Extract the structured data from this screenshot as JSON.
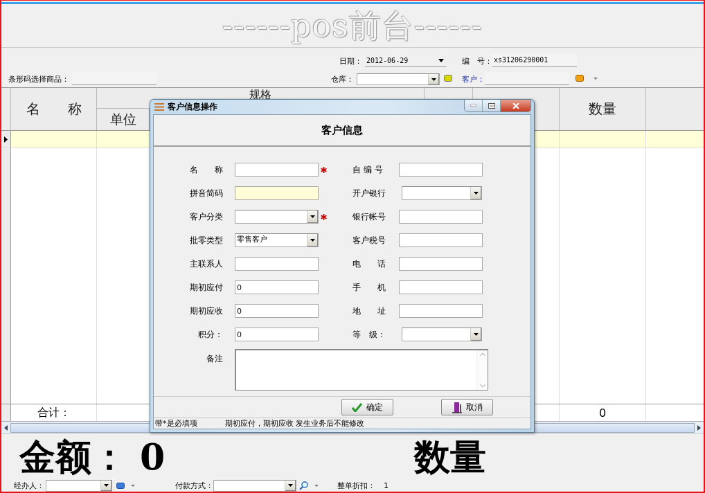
{
  "app_title": "------pos前台------",
  "header": {
    "date": {
      "label": "日期：",
      "value": "2012-06-29"
    },
    "number": {
      "label": "编　号：",
      "value": "xs31206290001"
    },
    "barcode": {
      "label": "条形码选择商品："
    },
    "warehouse": {
      "label": "仓库："
    },
    "customer": {
      "label": "客户："
    }
  },
  "table": {
    "columns": [
      {
        "label": "名　　称"
      },
      {
        "label": "规格",
        "sub": [
          {
            "label": "单位"
          }
        ]
      },
      {},
      {},
      {
        "label": "数量"
      },
      {}
    ],
    "rows": [
      {
        "selected": true
      }
    ],
    "totals": {
      "label": "合计：",
      "quantity": "0"
    }
  },
  "summary": {
    "amount_label": "金额：",
    "amount": "0",
    "quantity_label": "数量"
  },
  "footer": {
    "handler": {
      "label": "经办人："
    },
    "payment": {
      "label": "付款方式："
    },
    "discount": {
      "label": "整单折扣：",
      "value": "1"
    }
  },
  "dialog": {
    "title": "客户信息操作",
    "heading": "客户信息",
    "fields": [
      {
        "label": "名　　称",
        "kind": "text",
        "required": true
      },
      {
        "label": "自 编 号",
        "kind": "text",
        "required": false
      },
      {
        "label": "拼音简码",
        "kind": "text",
        "required": false,
        "highlighted": true
      },
      {
        "label": "开户银行",
        "kind": "combo",
        "required": false
      },
      {
        "label": "客户分类",
        "kind": "combo",
        "required": true
      },
      {
        "label": "银行帐号",
        "kind": "text",
        "required": false
      },
      {
        "label": "批零类型",
        "kind": "combo",
        "required": false,
        "value": "零售客户"
      },
      {
        "label": "客户税号",
        "kind": "text",
        "required": false
      },
      {
        "label": "主联系人",
        "kind": "text",
        "required": false
      },
      {
        "label": "电　　话",
        "kind": "text",
        "required": false
      },
      {
        "label": "期初应付",
        "kind": "text",
        "required": false,
        "value": "0"
      },
      {
        "label": "手　　机",
        "kind": "text",
        "required": false
      },
      {
        "label": "期初应收",
        "kind": "text",
        "required": false,
        "value": "0"
      },
      {
        "label": "地　　址",
        "kind": "text",
        "required": false
      },
      {
        "label": "积分：",
        "kind": "text",
        "required": false,
        "value": "0"
      },
      {
        "label": "等　级：",
        "kind": "combo",
        "required": false
      }
    ],
    "remark": {
      "label": "备注"
    },
    "buttons": [
      {
        "label": "确定",
        "kind": "ok"
      },
      {
        "label": "取消",
        "kind": "cancel"
      }
    ],
    "status": [
      "带*是必填项",
      "期初应付，期初应收 发生业务后不能修改"
    ]
  }
}
